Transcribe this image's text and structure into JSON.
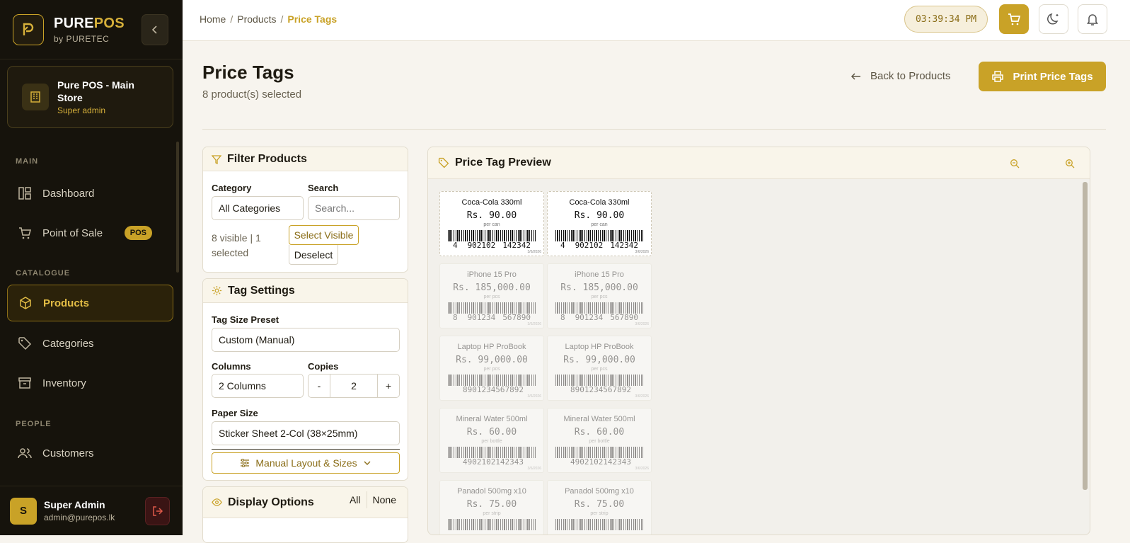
{
  "brand": {
    "name_a": "PURE",
    "name_b": "POS",
    "sub": "by PURETEC"
  },
  "store": {
    "name": "Pure POS - Main Store",
    "role": "Super admin"
  },
  "sidebar": {
    "sections": [
      "MAIN",
      "CATALOGUE",
      "PEOPLE"
    ],
    "items": [
      {
        "label": "Dashboard",
        "icon": "dashboard-icon"
      },
      {
        "label": "Point of Sale",
        "icon": "cart-icon",
        "badge": "POS"
      },
      {
        "label": "Products",
        "icon": "box-icon",
        "active": true
      },
      {
        "label": "Categories",
        "icon": "tag-icon"
      },
      {
        "label": "Inventory",
        "icon": "archive-icon"
      },
      {
        "label": "Customers",
        "icon": "users-icon"
      }
    ]
  },
  "user": {
    "initial": "S",
    "name": "Super Admin",
    "email": "admin@purepos.lk"
  },
  "breadcrumb": {
    "home": "Home",
    "products": "Products",
    "current": "Price Tags",
    "sep": "/"
  },
  "clock": "03:39:34 PM",
  "header": {
    "title": "Price Tags",
    "subtitle": "8 product(s) selected",
    "back_label": "Back to Products",
    "print_label": "Print Price Tags"
  },
  "filter": {
    "title": "Filter Products",
    "category_label": "Category",
    "category_value": "All Categories",
    "search_label": "Search",
    "search_placeholder": "Search...",
    "visible_note": "8 visible | 1 selected",
    "select_visible": "Select Visible",
    "deselect": "Deselect"
  },
  "tag_settings": {
    "title": "Tag Settings",
    "preset_label": "Tag Size Preset",
    "preset_value": "Custom (Manual)",
    "columns_label": "Columns",
    "columns_value": "2 Columns",
    "copies_label": "Copies",
    "copies_minus": "-",
    "copies_value": "2",
    "copies_plus": "+",
    "paper_label": "Paper Size",
    "paper_value": "Sticker Sheet 2-Col (38×25mm)",
    "manual_label": "Manual Layout & Sizes"
  },
  "display_options": {
    "title": "Display Options",
    "all": "All",
    "none": "None"
  },
  "preview": {
    "title": "Price Tag Preview",
    "tags": [
      {
        "name": "Coca-Cola 330ml",
        "price": "Rs. 90.00",
        "unit": "per can",
        "code_a": "4",
        "code_b": "902102",
        "code_c": "142342",
        "date": "3/6/2026",
        "dim": false
      },
      {
        "name": "iPhone 15 Pro",
        "price": "Rs. 185,000.00",
        "unit": "per pcs",
        "code_a": "8",
        "code_b": "901234",
        "code_c": "567890",
        "date": "3/6/2026",
        "dim": true
      },
      {
        "name": "Laptop HP ProBook",
        "price": "Rs. 99,000.00",
        "unit": "per pcs",
        "code_a": "",
        "code_b": "8901234567892",
        "code_c": "",
        "date": "3/6/2026",
        "dim": true
      },
      {
        "name": "Mineral Water 500ml",
        "price": "Rs. 60.00",
        "unit": "per bottle",
        "code_a": "",
        "code_b": "4902102142343",
        "code_c": "",
        "date": "3/6/2026",
        "dim": true
      },
      {
        "name": "Panadol 500mg x10",
        "price": "Rs. 75.00",
        "unit": "per strip",
        "code_a": "",
        "code_b": "",
        "code_c": "",
        "date": "",
        "dim": true
      }
    ]
  },
  "colors": {
    "accent": "#c9a227",
    "sidebar_bg": "#16130c",
    "page_bg": "#f7f4ee"
  }
}
